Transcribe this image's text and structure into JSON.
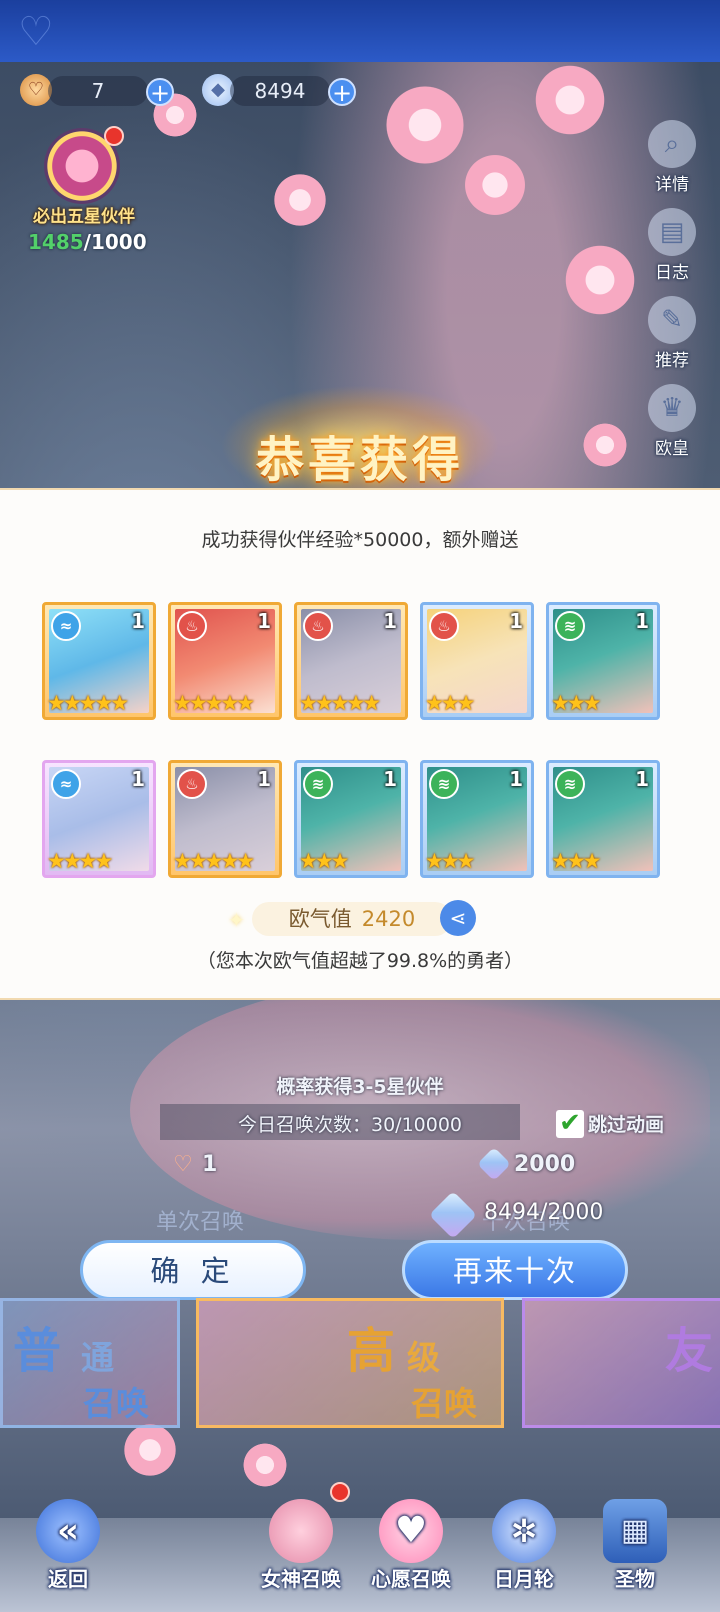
{
  "resources": {
    "ticket_count": "7",
    "gem_count": "8494"
  },
  "guarantee": {
    "label": "必出五星伙伴",
    "current": "1485",
    "separator_total": "/1000"
  },
  "side_menu": [
    {
      "label": "详情",
      "icon": "magnifier-icon"
    },
    {
      "label": "日志",
      "icon": "book-icon"
    },
    {
      "label": "推荐",
      "icon": "feather-icon"
    },
    {
      "label": "欧皇",
      "icon": "crown-icon"
    }
  ],
  "result": {
    "title": "恭喜获得",
    "subtitle": "成功获得伙伴经验*50000，额外赠送",
    "cards": [
      {
        "frame": "gold",
        "element": "water",
        "stars": "★★★★★",
        "level": "1"
      },
      {
        "frame": "gold",
        "element": "fire",
        "stars": "★★★★★",
        "level": "1"
      },
      {
        "frame": "gold",
        "element": "fire",
        "stars": "★★★★★",
        "level": "1"
      },
      {
        "frame": "blue",
        "element": "fire",
        "stars": "★★★",
        "level": "1"
      },
      {
        "frame": "blue",
        "element": "wind",
        "stars": "★★★",
        "level": "1"
      },
      {
        "frame": "pink",
        "element": "water",
        "stars": "★★★★",
        "level": "1"
      },
      {
        "frame": "gold",
        "element": "fire",
        "stars": "★★★★★",
        "level": "1"
      },
      {
        "frame": "blue",
        "element": "wind",
        "stars": "★★★",
        "level": "1"
      },
      {
        "frame": "blue",
        "element": "wind",
        "stars": "★★★",
        "level": "1"
      },
      {
        "frame": "blue",
        "element": "wind",
        "stars": "★★★",
        "level": "1"
      }
    ],
    "luck_label": "欧气值",
    "luck_value": "2420",
    "luck_note": "（您本次欧气值超越了99.8%的勇者）"
  },
  "summon": {
    "probability_text": "概率获得3-5星伙伴",
    "daily_count_text": "今日召唤次数：30/10000",
    "skip_animation_label": "跳过动画",
    "single_cost": "1",
    "ten_cost": "2000",
    "gem_balance": "8494/2000",
    "single_label": "单次召唤",
    "ten_label": "十次召唤",
    "confirm_label": "确 定",
    "again_label": "再来十次"
  },
  "banners": [
    {
      "big": "普",
      "small1": "通",
      "small2": "召唤"
    },
    {
      "big": "高",
      "small1": "级",
      "small2": "召唤"
    },
    {
      "big": "友",
      "small1": "",
      "small2": ""
    }
  ],
  "nav": {
    "back": "返回",
    "goddess": "女神召唤",
    "wish": "心愿召唤",
    "sunmoon": "日月轮",
    "relic": "圣物"
  },
  "colors": {
    "gold_frame": "#f0a935",
    "blue_frame": "#7fb3ef",
    "pink_frame": "#e3a6ef",
    "accent_blue": "#3b78e6",
    "star": "#ffc21a"
  }
}
